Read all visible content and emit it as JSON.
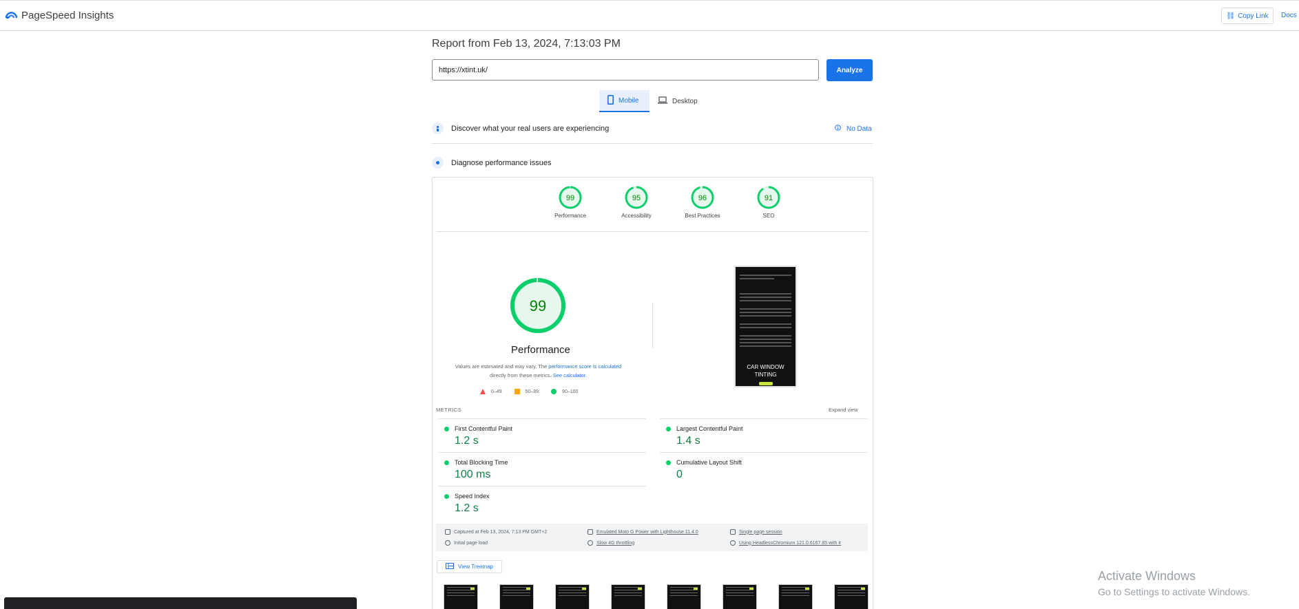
{
  "header": {
    "app_title": "PageSpeed Insights",
    "copy_link_label": "Copy Link",
    "docs_label": "Docs"
  },
  "report": {
    "title": "Report from Feb 13, 2024, 7:13:03 PM",
    "url_value": "https://xtint.uk/",
    "analyze_label": "Analyze"
  },
  "tabs": [
    {
      "label": "Mobile",
      "selected": true
    },
    {
      "label": "Desktop",
      "selected": false
    }
  ],
  "sections": {
    "real_users": "Discover what your real users are experiencing",
    "no_data": "No Data",
    "diagnose": "Diagnose performance issues"
  },
  "scores": [
    {
      "value": "99",
      "label": "Performance",
      "fraction": 0.99
    },
    {
      "value": "95",
      "label": "Accessibility",
      "fraction": 0.95
    },
    {
      "value": "96",
      "label": "Best Practices",
      "fraction": 0.96
    },
    {
      "value": "91",
      "label": "SEO",
      "fraction": 0.91
    }
  ],
  "performance": {
    "score": "99",
    "score_fraction": 0.99,
    "title": "Performance",
    "note_prefix": "Values are estimated and may vary. The ",
    "note_link1": "performance score is calculated",
    "note_middle": " directly from these metrics. ",
    "note_link2": "See calculator.",
    "legend": [
      "0–49",
      "50–89",
      "90–100"
    ]
  },
  "screenshot_preview": {
    "title": "CAR WINDOW TINTING"
  },
  "metrics": {
    "label": "METRICS",
    "expand_label": "Expand view",
    "items": [
      {
        "name": "First Contentful Paint",
        "value": "1.2 s"
      },
      {
        "name": "Largest Contentful Paint",
        "value": "1.4 s"
      },
      {
        "name": "Total Blocking Time",
        "value": "100 ms"
      },
      {
        "name": "Cumulative Layout Shift",
        "value": "0"
      },
      {
        "name": "Speed Index",
        "value": "1.2 s"
      }
    ]
  },
  "runtime": {
    "captured": "Captured at Feb 13, 2024, 7:13 PM GMT+2",
    "initial_load": "Initial page load",
    "device": "Emulated Moto G Power with Lighthouse 11.4.0",
    "throttling": "Slow 4G throttling",
    "session": "Single page session",
    "browser": "Using HeadlessChromium 121.0.6167.85 with lr"
  },
  "treemap_label": "View Treemap",
  "windows": {
    "activate_title": "Activate Windows",
    "activate_sub": "Go to Settings to activate Windows."
  },
  "colors": {
    "accent": "#1a73e8",
    "pass": "#0cce6b",
    "pass_text": "#008800",
    "average": "#ffa400",
    "fail": "#ff4e42"
  }
}
